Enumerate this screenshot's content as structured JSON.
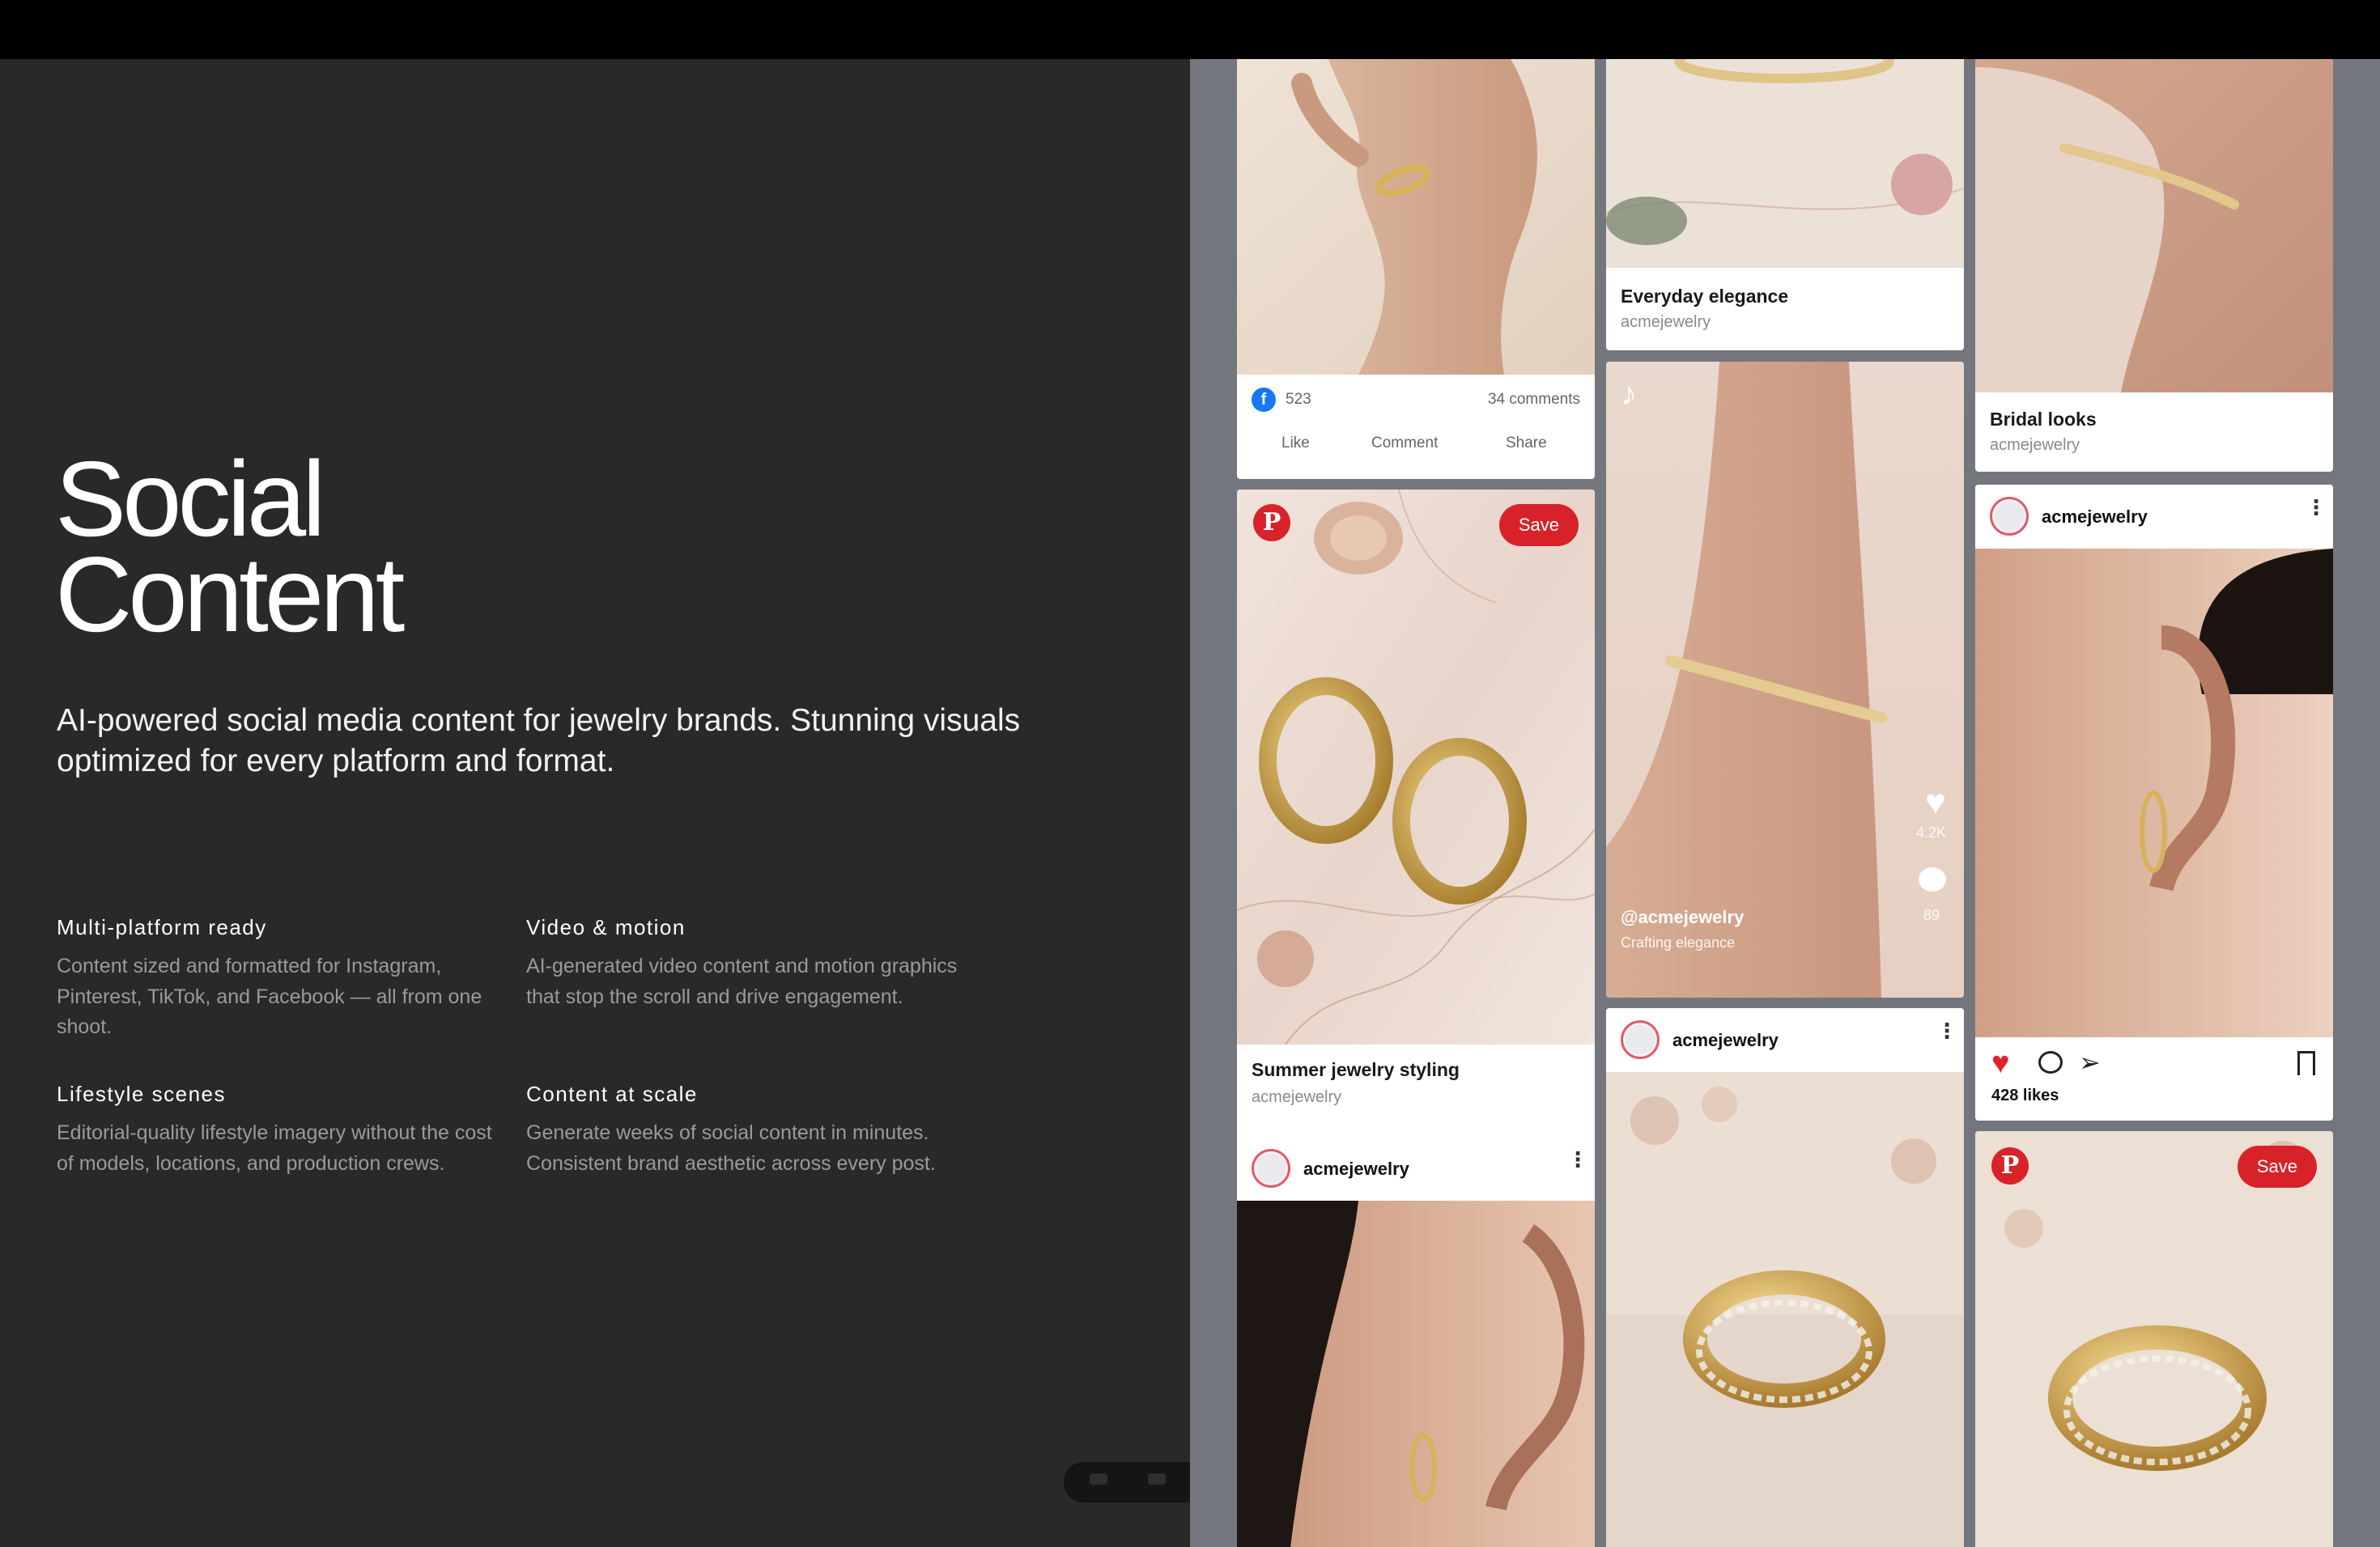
{
  "hero": {
    "title_line1": "Social",
    "title_line2": "Content",
    "subtitle": "AI-powered social media content for jewelry brands. Stunning visuals optimized for every platform and format."
  },
  "features": [
    {
      "title": "Multi-platform ready",
      "text": "Content sized and formatted for Instagram, Pinterest, TikTok, and Facebook — all from one shoot."
    },
    {
      "title": "Video & motion",
      "text": "AI-generated video content and motion graphics that stop the scroll and drive engagement."
    },
    {
      "title": "Lifestyle scenes",
      "text": "Editorial-quality lifestyle imagery without the cost of models, locations, and production crews."
    },
    {
      "title": "Content at scale",
      "text": "Generate weeks of social content in minutes. Consistent brand aesthetic across every post."
    }
  ],
  "facebook_post": {
    "reactions": "523",
    "comments": "34 comments",
    "like": "Like",
    "comment": "Comment",
    "share": "Share"
  },
  "pin_earrings": {
    "save": "Save",
    "title": "Summer jewelry styling",
    "handle": "acmejewelry"
  },
  "ig_post_1": {
    "name": "acmejewelry"
  },
  "caption_elegance": {
    "title": "Everyday elegance",
    "handle": "acmejewelry"
  },
  "tiktok": {
    "likes": "4.2K",
    "comments": "89",
    "handle": "@acmejewelry",
    "caption": "Crafting elegance"
  },
  "ig_post_2": {
    "name": "acmejewelry"
  },
  "caption_bridal": {
    "title": "Bridal looks",
    "handle": "acmejewelry"
  },
  "ig_post_3": {
    "name": "acmejewelry",
    "likes": "428 likes"
  },
  "pin_ring": {
    "save": "Save"
  },
  "colors": {
    "pinterest": "#d8222a",
    "facebook": "#1877f2",
    "background_left": "#292929",
    "background_right": "#73767d"
  }
}
